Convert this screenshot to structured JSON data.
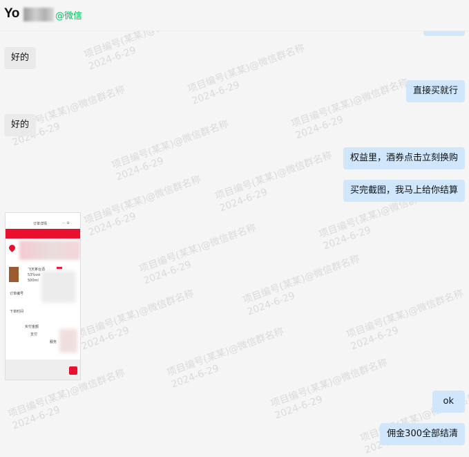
{
  "header": {
    "contact_name": "Yo",
    "source_tag": "@微信"
  },
  "messages": [
    {
      "side": "left",
      "text": "好的"
    },
    {
      "side": "right",
      "text": "直接买就行"
    },
    {
      "side": "left",
      "text": "好的"
    },
    {
      "side": "right",
      "text": "权益里，酒券点击立刻换购"
    },
    {
      "side": "right",
      "text": "买完截图，我马上给你结算"
    },
    {
      "side": "right",
      "text": "ok"
    },
    {
      "side": "right",
      "text": "佣金300全部结清"
    }
  ],
  "watermark": {
    "line1": "项目编号(某某)@微信群名称",
    "date": "2024-6-29"
  },
  "shared_image": {
    "title": "订单详情",
    "product_line1": "飞天茅台酒",
    "product_line2": "53%vol",
    "product_line3": "500ml",
    "order_label": "订单编号",
    "time_label": "下单时间",
    "amount_label": "实付金额",
    "pay_label": "支付",
    "status_label": "服务"
  },
  "colors": {
    "background": "#f5f5f5",
    "bubble_left": "#eaeaea",
    "bubble_right": "#cfe6fb",
    "wechat_green": "#07c160",
    "accent_red": "#e8102e"
  }
}
